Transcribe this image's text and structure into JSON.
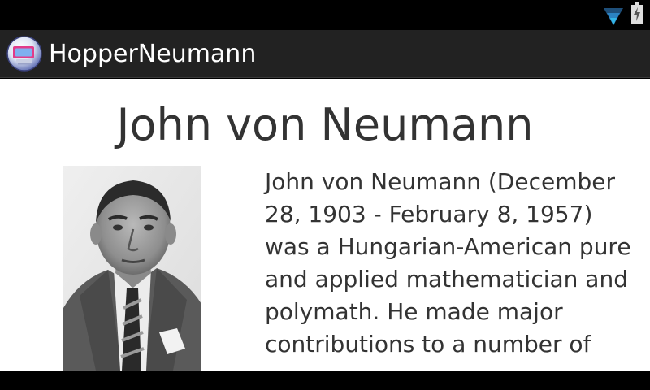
{
  "status_bar": {
    "icons": [
      "wifi-icon",
      "battery-charging-icon"
    ],
    "accent_color": "#33b5e5"
  },
  "action_bar": {
    "app_icon": "app-icon",
    "title": "HopperNeumann"
  },
  "content": {
    "heading": "John von Neumann",
    "portrait_subject": "portrait-photo",
    "bio": "John von Neumann (December 28, 1903 - February 8, 1957) was a Hungarian-American pure and applied mathematician and polymath. He made major contributions to a number of"
  }
}
